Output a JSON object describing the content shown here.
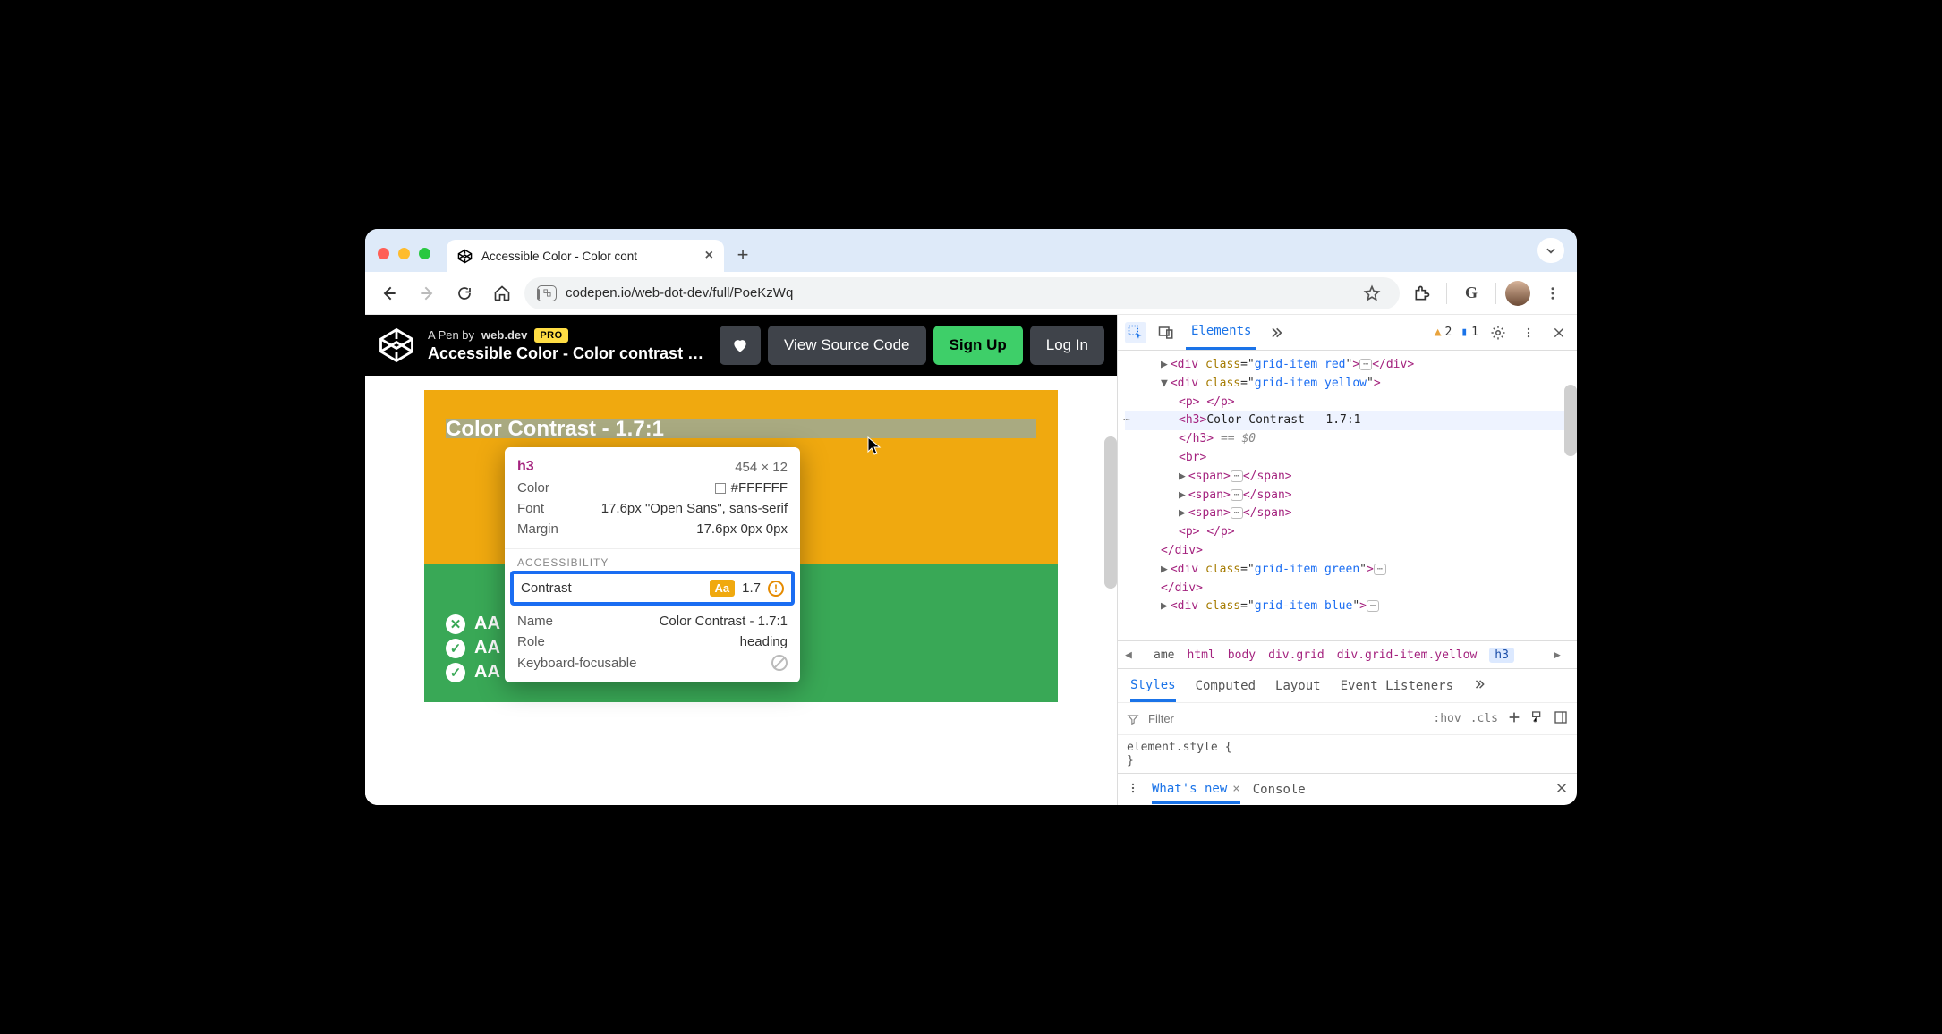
{
  "tab": {
    "title": "Accessible Color - Color cont"
  },
  "url": "codepen.io/web-dot-dev/full/PoeKzWq",
  "codepen": {
    "by_prefix": "A Pen by ",
    "author": "web.dev",
    "pro": "PRO",
    "title": "Accessible Color - Color contrast …",
    "view_source": "View Source Code",
    "sign_up": "Sign Up",
    "log_in": "Log In"
  },
  "page": {
    "yellow_heading": "Color Contrast - 1.7:1",
    "green_lines": [
      {
        "status": "fail",
        "text": "AA Fail - regular text"
      },
      {
        "status": "pass",
        "text": "AA Pass - large text"
      },
      {
        "status": "pass",
        "text": "AA Pass - icons"
      }
    ]
  },
  "inspect": {
    "tag": "h3",
    "dim": "454 × 12",
    "color_label": "Color",
    "color_value": "#FFFFFF",
    "font_label": "Font",
    "font_value": "17.6px \"Open Sans\", sans-serif",
    "margin_label": "Margin",
    "margin_value": "17.6px 0px 0px",
    "acc_head": "ACCESSIBILITY",
    "contrast_label": "Contrast",
    "contrast_aa": "Aa",
    "contrast_value": "1.7",
    "name_label": "Name",
    "name_value": "Color Contrast - 1.7:1",
    "role_label": "Role",
    "role_value": "heading",
    "kb_label": "Keyboard-focusable"
  },
  "devtools": {
    "tabs": {
      "elements": "Elements"
    },
    "warn_count": "2",
    "info_count": "1",
    "dom": {
      "red": "grid-item red",
      "yellow": "grid-item yellow",
      "h3_text": "Color Contrast – 1.7:1",
      "eq0": " == $0",
      "green": "grid-item green",
      "blue": "grid-item blue"
    },
    "crumb": {
      "ame": "ame",
      "html": "html",
      "body": "body",
      "grid": "div.grid",
      "yellow": "div.grid-item.yellow",
      "h3": "h3"
    },
    "styles": {
      "styles": "Styles",
      "computed": "Computed",
      "layout": "Layout",
      "events": "Event Listeners",
      "filter": "Filter",
      "hov": ":hov",
      "cls": ".cls",
      "elstyle_open": "element.style {",
      "elstyle_close": "}"
    },
    "drawer": {
      "whatsnew": "What's new",
      "console": "Console"
    }
  }
}
